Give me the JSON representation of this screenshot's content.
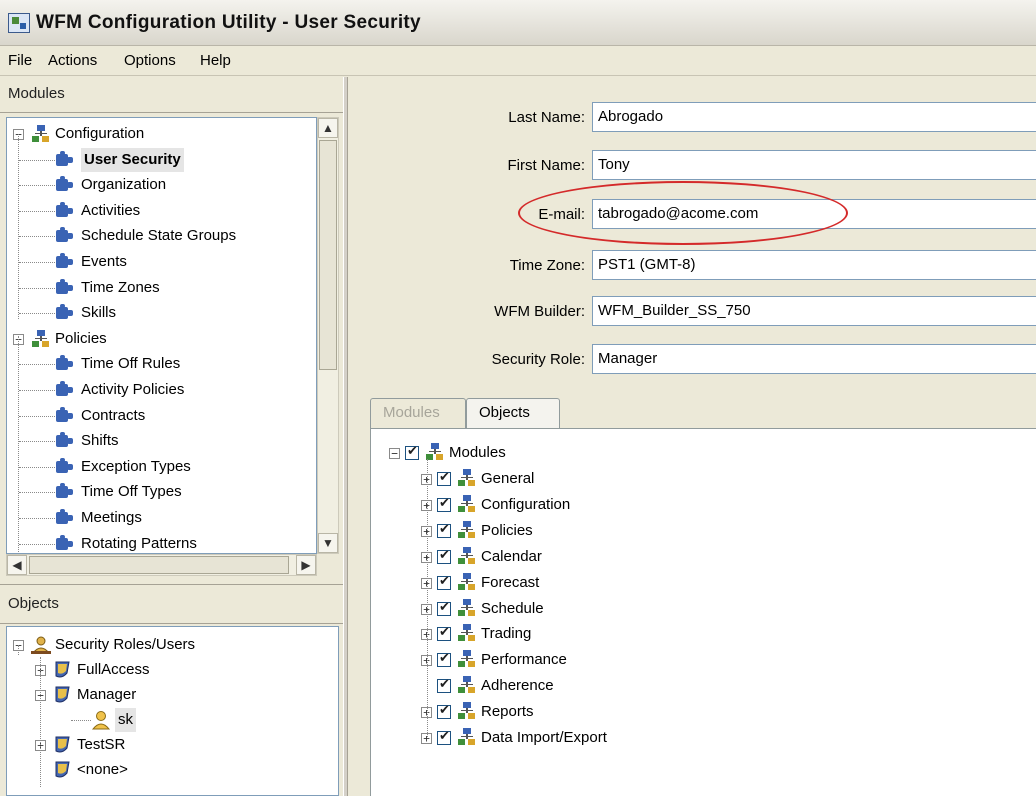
{
  "window": {
    "title": "WFM Configuration Utility - User Security"
  },
  "menu": {
    "items": [
      "File",
      "Actions",
      "Options",
      "Help"
    ]
  },
  "modules_panel": {
    "header": "Modules",
    "tree": [
      {
        "label": "Configuration",
        "level": 0,
        "type": "group",
        "expanded": true
      },
      {
        "label": "User Security",
        "level": 1,
        "type": "module",
        "selected": true
      },
      {
        "label": "Organization",
        "level": 1,
        "type": "module"
      },
      {
        "label": "Activities",
        "level": 1,
        "type": "module"
      },
      {
        "label": "Schedule State Groups",
        "level": 1,
        "type": "module"
      },
      {
        "label": "Events",
        "level": 1,
        "type": "module"
      },
      {
        "label": "Time Zones",
        "level": 1,
        "type": "module"
      },
      {
        "label": "Skills",
        "level": 1,
        "type": "module"
      },
      {
        "label": "Policies",
        "level": 0,
        "type": "group",
        "expanded": true
      },
      {
        "label": "Time Off Rules",
        "level": 1,
        "type": "module"
      },
      {
        "label": "Activity Policies",
        "level": 1,
        "type": "module"
      },
      {
        "label": "Contracts",
        "level": 1,
        "type": "module"
      },
      {
        "label": "Shifts",
        "level": 1,
        "type": "module"
      },
      {
        "label": "Exception Types",
        "level": 1,
        "type": "module"
      },
      {
        "label": "Time Off Types",
        "level": 1,
        "type": "module"
      },
      {
        "label": "Meetings",
        "level": 1,
        "type": "module"
      },
      {
        "label": "Rotating Patterns",
        "level": 1,
        "type": "module"
      }
    ]
  },
  "objects_panel": {
    "header": "Objects",
    "tree": [
      {
        "label": "Security Roles/Users",
        "level": 0,
        "type": "root",
        "expander": "-"
      },
      {
        "label": "FullAccess",
        "level": 1,
        "type": "role",
        "expander": "+"
      },
      {
        "label": "Manager",
        "level": 1,
        "type": "role",
        "expander": "-"
      },
      {
        "label": "sk",
        "level": 2,
        "type": "user",
        "selected": true
      },
      {
        "label": "TestSR",
        "level": 1,
        "type": "role",
        "expander": "+"
      },
      {
        "label": "<none>",
        "level": 1,
        "type": "role"
      }
    ]
  },
  "user_form": {
    "last_name": {
      "label": "Last Name:",
      "value": "Abrogado"
    },
    "first_name": {
      "label": "First Name:",
      "value": "Tony"
    },
    "email": {
      "label": "E-mail:",
      "value": "tabrogado@acome.com"
    },
    "time_zone": {
      "label": "Time Zone:",
      "value": "PST1 (GMT-8)"
    },
    "wfm_builder": {
      "label": "WFM Builder:",
      "value": "WFM_Builder_SS_750"
    },
    "security_role": {
      "label": "Security Role:",
      "value": "Manager"
    }
  },
  "tabs": [
    {
      "label": "Modules",
      "active": false
    },
    {
      "label": "Objects",
      "active": true
    }
  ],
  "permissions_tree": {
    "root": {
      "label": "Modules",
      "checked": true
    },
    "items": [
      {
        "label": "General",
        "checked": true,
        "expandable": true
      },
      {
        "label": "Configuration",
        "checked": true,
        "expandable": true
      },
      {
        "label": "Policies",
        "checked": true,
        "expandable": true
      },
      {
        "label": "Calendar",
        "checked": true,
        "expandable": true
      },
      {
        "label": "Forecast",
        "checked": true,
        "expandable": true
      },
      {
        "label": "Schedule",
        "checked": true,
        "expandable": true
      },
      {
        "label": "Trading",
        "checked": true,
        "expandable": true
      },
      {
        "label": "Performance",
        "checked": true,
        "expandable": true
      },
      {
        "label": "Adherence",
        "checked": true,
        "expandable": false
      },
      {
        "label": "Reports",
        "checked": true,
        "expandable": true
      },
      {
        "label": "Data Import/Export",
        "checked": true,
        "expandable": true
      }
    ]
  },
  "colors": {
    "highlight": "#d42a2a",
    "selection_bg": "#e5e5e5",
    "tree_border": "#7f9db9"
  }
}
